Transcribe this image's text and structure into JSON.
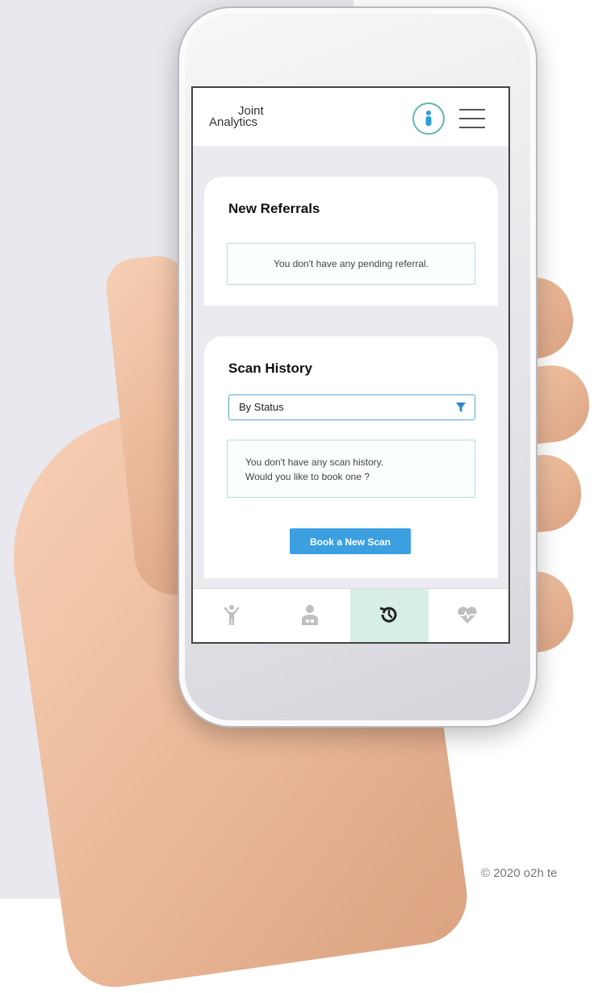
{
  "app": {
    "logo_line1": "Joint",
    "logo_line2": "Analytics"
  },
  "header": {
    "info_icon": "person-info-icon",
    "menu_icon": "hamburger-menu-icon"
  },
  "referrals": {
    "title": "New Referrals",
    "empty_message": "You don't have any pending referral."
  },
  "history": {
    "title": "Scan History",
    "filter_selected": "By Status",
    "filter_icon": "filter-icon",
    "empty_line1": "You don't have any scan history.",
    "empty_line2": "Would you like to book one ?",
    "book_button_label": "Book a New Scan"
  },
  "bottom_nav": {
    "items": [
      {
        "icon": "person-stretch-icon",
        "active": false
      },
      {
        "icon": "doctor-icon",
        "active": false
      },
      {
        "icon": "history-icon",
        "active": true
      },
      {
        "icon": "heartbeat-icon",
        "active": false
      }
    ]
  },
  "footer": {
    "copyright": "© 2020 o2h te"
  },
  "colors": {
    "accent": "#3b9fe0",
    "teal": "#62b7b0",
    "active_tab_bg": "#d7eee6",
    "page_bg_left": "#e8e8ee"
  }
}
